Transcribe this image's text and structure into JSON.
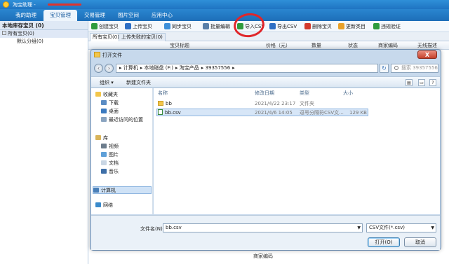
{
  "app": {
    "title": "淘宝助理 -"
  },
  "menu": [
    "我的助理",
    "宝贝管理",
    "交易管理",
    "图片空间",
    "应用中心"
  ],
  "left_panel": {
    "header": "本地库存宝贝 (0)",
    "tree": [
      {
        "label": "所有宝贝(0)"
      },
      {
        "label": "默认分组(0)"
      }
    ]
  },
  "toolbar": {
    "buttons": [
      "创建宝贝",
      "上传宝贝",
      "同步宝贝",
      "批量编辑",
      "导入CSV",
      "导出CSV",
      "删除宝贝",
      "更新类目",
      "违规验证"
    ]
  },
  "tabs": [
    "所有宝贝(0)",
    "上传失败的宝贝(0)"
  ],
  "grid": {
    "headers": [
      "宝贝标题",
      "价格（元）",
      "数量",
      "状态",
      "商家编码",
      "无线描述"
    ],
    "bottom_label": "商家编码"
  },
  "dialog": {
    "title": "打开文件",
    "close": "X",
    "address": [
      "计算机",
      "本地磁盘 (F:)",
      "淘宝产品",
      "39357556"
    ],
    "search_placeholder": "搜索 39357556",
    "commands": {
      "organize": "组织 ▾",
      "new_folder": "新建文件夹"
    },
    "nav": {
      "favorites_header": "收藏夹",
      "favorites": [
        "下载",
        "桌面",
        "最近访问的位置"
      ],
      "library_header": "库",
      "libraries": [
        "视频",
        "图片",
        "文档",
        "音乐"
      ],
      "computer": "计算机",
      "network": "网络"
    },
    "columns": [
      "名称",
      "修改日期",
      "类型",
      "大小"
    ],
    "files": [
      {
        "name": "bb",
        "date": "2021/4/22 23:17",
        "type": "文件夹",
        "size": ""
      },
      {
        "name": "bb.csv",
        "date": "2021/4/6 14:05",
        "type": "逗号分隔符CSV文...",
        "size": "129 KB"
      }
    ],
    "filename_label": "文件名(N):",
    "filename_value": "bb.csv",
    "filetype_value": "CSV文件(*.csv)",
    "open_button": "打开(O)",
    "cancel_button": "取消"
  },
  "colors": {
    "accent": "#1f74c2",
    "annotation": "#e0262a"
  }
}
